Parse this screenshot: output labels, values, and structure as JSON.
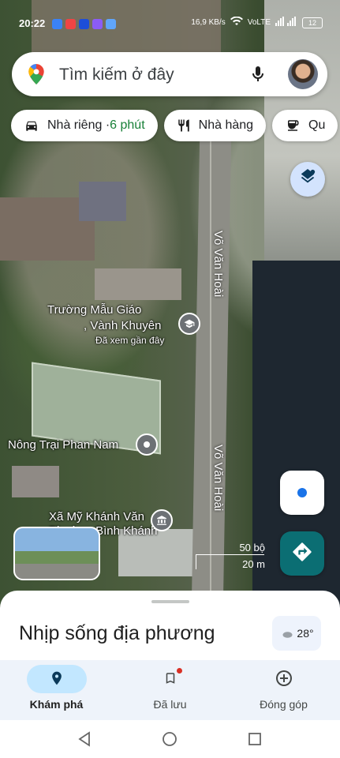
{
  "status_bar": {
    "time": "20:22",
    "speed": "16,9 KB/s",
    "network": "VoLTE",
    "battery": "12"
  },
  "search": {
    "placeholder": "Tìm kiếm ở đây"
  },
  "chips": [
    {
      "icon": "car-icon",
      "label": "Nhà riêng · ",
      "eta": "6 phút"
    },
    {
      "icon": "restaurant-icon",
      "label": "Nhà hàng"
    },
    {
      "icon": "coffee-icon",
      "label": "Qu"
    }
  ],
  "map": {
    "streets": [
      "Võ Văn Hoài",
      "Võ Văn Hoài"
    ],
    "places": [
      {
        "line1": "Trường Mẫu Giáo",
        "line2": ", Vành Khuyên",
        "note": "Đã xem gần đây"
      },
      {
        "line1": "Nông Trại Phan Nam"
      },
      {
        "line1": "Xã Mỹ Khánh Văn",
        "line2": "Phường Bình Khánh"
      }
    ],
    "scale": {
      "feet": "50 bộ",
      "meters": "20 m"
    }
  },
  "sheet": {
    "title": "Nhịp sống địa phương",
    "weather": "28°"
  },
  "nav": [
    {
      "label": "Khám phá",
      "icon": "explore-pin-icon",
      "active": true
    },
    {
      "label": "Đã lưu",
      "icon": "bookmark-icon",
      "active": false
    },
    {
      "label": "Đóng góp",
      "icon": "add-circle-icon",
      "active": false
    }
  ],
  "colors": {
    "accent": "#1a73e8",
    "eta_green": "#188038",
    "directions": "#0b6e73",
    "nav_active": "#c2e7ff"
  }
}
